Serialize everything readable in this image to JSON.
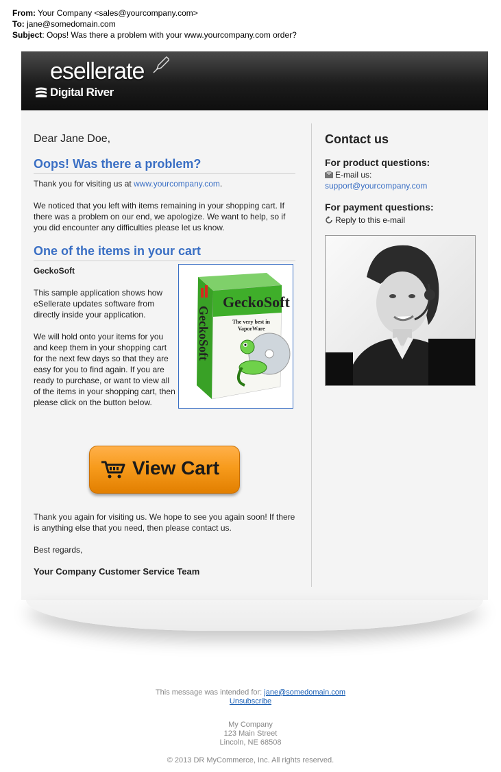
{
  "email": {
    "from_label": "From:",
    "from_value": "Your Company <sales@yourcompany.com>",
    "to_label": "To:",
    "to_value": "jane@somedomain.com",
    "subject_label": "Subject",
    "subject_value": ": Oops! Was there a problem with your www.yourcompany.com order?"
  },
  "banner": {
    "logo_text": "esellerate",
    "sub_logo": "Digital River"
  },
  "main": {
    "greeting": "Dear Jane Doe,",
    "heading1": "Oops! Was there a problem?",
    "thanks_prefix": "Thank you for visiting us at ",
    "thanks_link": "www.yourcompany.com",
    "thanks_suffix": ".",
    "para1": "We noticed that you left with items remaining in your shopping cart. If there was a problem on our end, we apologize. We want to help, so if you did encounter any difficulties please let us know.",
    "heading2": "One of the items in your cart",
    "product_name": "GeckoSoft",
    "product_desc": "This sample application shows how eSellerate updates software from directly inside your application.",
    "hold_text": "We will hold onto your items for you and keep them in your shopping cart for the next few days so that they are easy for you to find again. If you are ready to purchase, or want to view all of the items in your shopping cart, then please click on the button below.",
    "box_brand": "GeckoSoft",
    "box_tagline1": "The very best in",
    "box_tagline2": "VaporWare",
    "view_cart_label": "View Cart",
    "closing": "Thank you again for visiting us. We hope to see you again soon! If there is anything else that you need, then please contact us.",
    "regards": "Best regards,",
    "signature": "Your Company Customer Service Team"
  },
  "contact": {
    "title": "Contact us",
    "product_q": "For product questions:",
    "email_label": "E-mail us:",
    "email_link": "support@yourcompany.com",
    "payment_q": "For payment questions:",
    "reply_label": "Reply to this e-mail"
  },
  "footer": {
    "intended_prefix": "This message was intended for: ",
    "intended_email": "jane@somedomain.com",
    "unsubscribe": "Unsubscribe",
    "company": "My Company",
    "street": "123 Main Street",
    "city": "Lincoln, NE 68508",
    "copyright": "© 2013 DR MyCommerce, Inc. All rights reserved."
  },
  "colors": {
    "link": "#3a6fc4",
    "button_orange": "#f79b1c",
    "banner_dark": "#1c1c1c"
  }
}
